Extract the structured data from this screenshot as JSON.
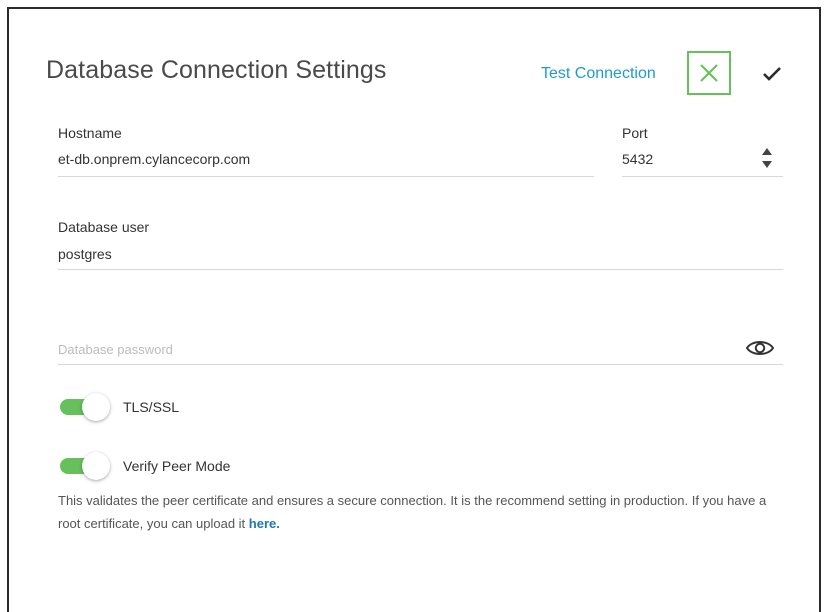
{
  "dialog": {
    "title": "Database Connection Settings",
    "test_connection_label": "Test Connection"
  },
  "fields": {
    "hostname": {
      "label": "Hostname",
      "value": "et-db.onprem.cylancecorp.com"
    },
    "port": {
      "label": "Port",
      "value": "5432"
    },
    "db_user": {
      "label": "Database user",
      "value": "postgres"
    },
    "db_password": {
      "placeholder": "Database password",
      "value": ""
    }
  },
  "toggles": {
    "tls_ssl": {
      "label": "TLS/SSL",
      "on": true
    },
    "verify_peer": {
      "label": "Verify Peer Mode",
      "on": true
    }
  },
  "help": {
    "text": "This validates the peer certificate and ensures a secure connection. It is the recommend setting in production. If you have a root certificate, you can upload it ",
    "link_label": "here."
  },
  "colors": {
    "accent_green": "#67c05b",
    "link_blue": "#1f9bd1"
  },
  "icons": {
    "cancel": "close-icon",
    "confirm": "checkmark-icon",
    "stepper": "stepper-arrows-icon",
    "password_visibility": "eye-icon"
  }
}
